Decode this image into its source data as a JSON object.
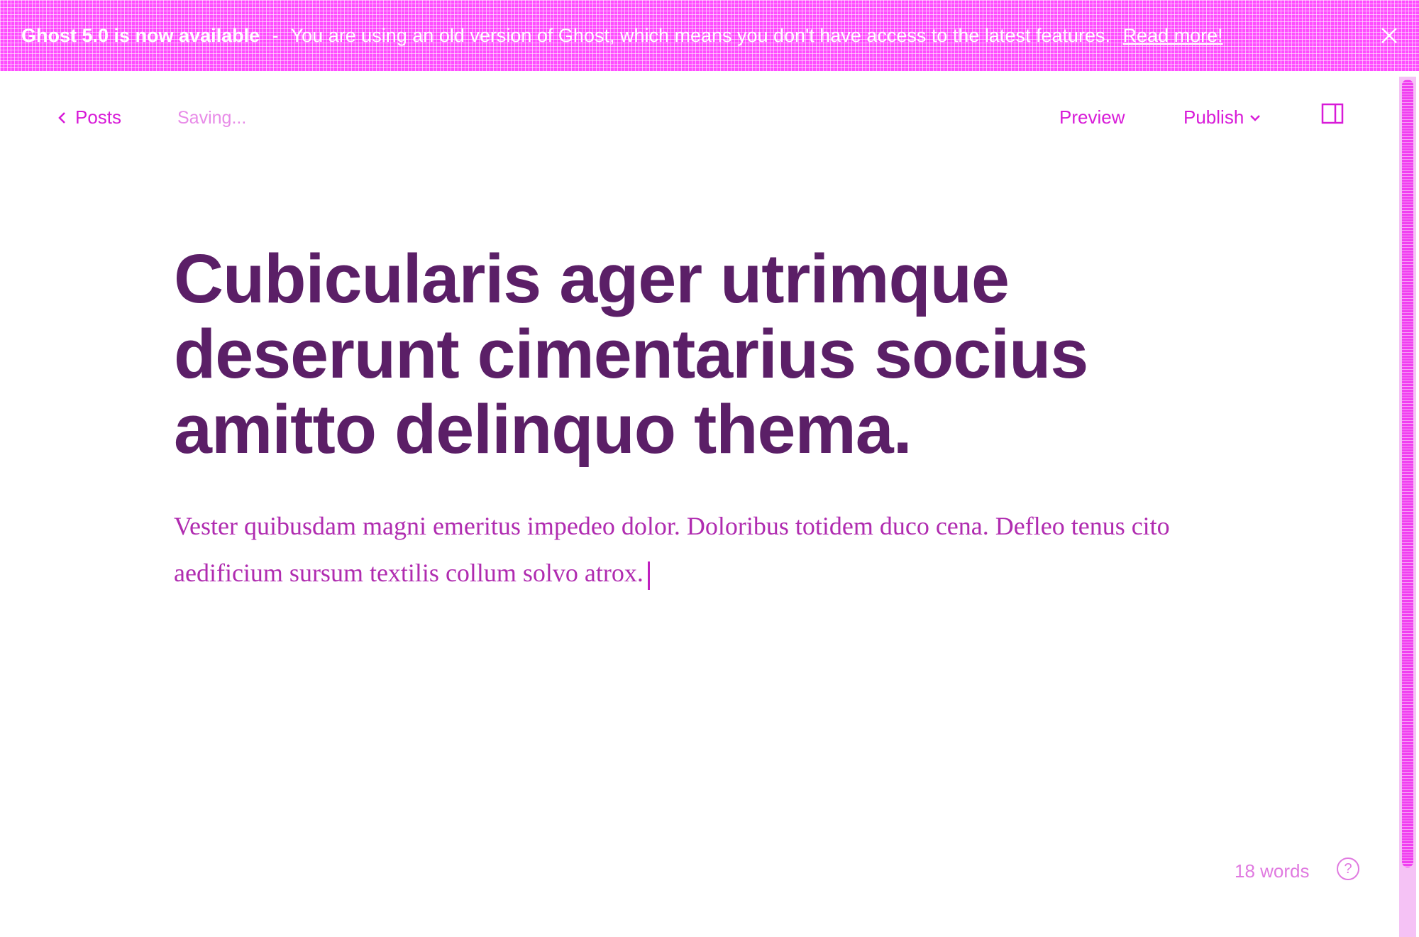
{
  "banner": {
    "headline": "Ghost 5.0 is now available",
    "separator": "-",
    "message": "You are using an old version of Ghost, which means you don't have access to the latest features.",
    "link_label": "Read more!",
    "close_icon": "close-icon"
  },
  "topbar": {
    "back_label": "Posts",
    "save_status": "Saving...",
    "preview_label": "Preview",
    "publish_label": "Publish",
    "sidebar_toggle_icon": "sidebar-toggle-icon"
  },
  "post": {
    "title_line_1": "Cubicularis ager utrimque",
    "title_line_2": "deserunt cimentarius socius",
    "title_line_3": "amitto delinquo thema.",
    "body": "Vester quibusdam magni emeritus impedeo dolor. Doloribus totidem duco cena. Defleo tenus cito aedificium sursum textilis collum solvo atrox."
  },
  "footer": {
    "word_count": "18 words",
    "help_icon": "help-icon",
    "help_symbol": "?"
  },
  "colors": {
    "banner_bg": "#ff4dff",
    "accent": "#d81bd8",
    "title": "#5b1f67"
  }
}
